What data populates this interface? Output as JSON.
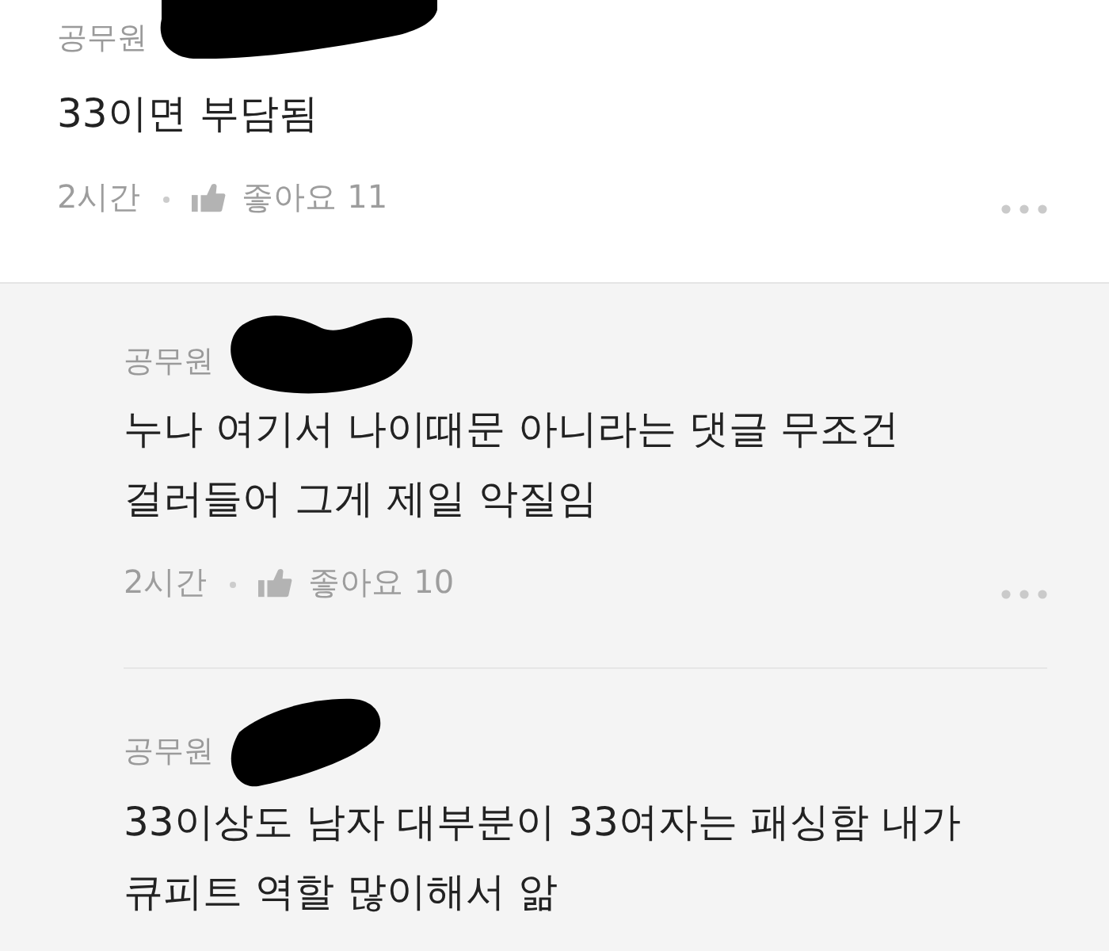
{
  "comments": [
    {
      "kind": "comment",
      "author": "공무원",
      "name_redacted": true,
      "body": "33이면 부담됨",
      "time": "2시간",
      "likes": "좋아요 11"
    },
    {
      "kind": "reply",
      "author": "공무원",
      "name_redacted": true,
      "body": "누나 여기서 나이때문 아니라는 댓글 무조건 걸러들어 그게 제일 악질임",
      "time": "2시간",
      "likes": "좋아요 10"
    },
    {
      "kind": "reply",
      "author": "공무원",
      "name_redacted": true,
      "body": "33이상도 남자 대부분이 33여자는 패싱함 내가 큐피트 역할 많이해서 앎"
    }
  ]
}
